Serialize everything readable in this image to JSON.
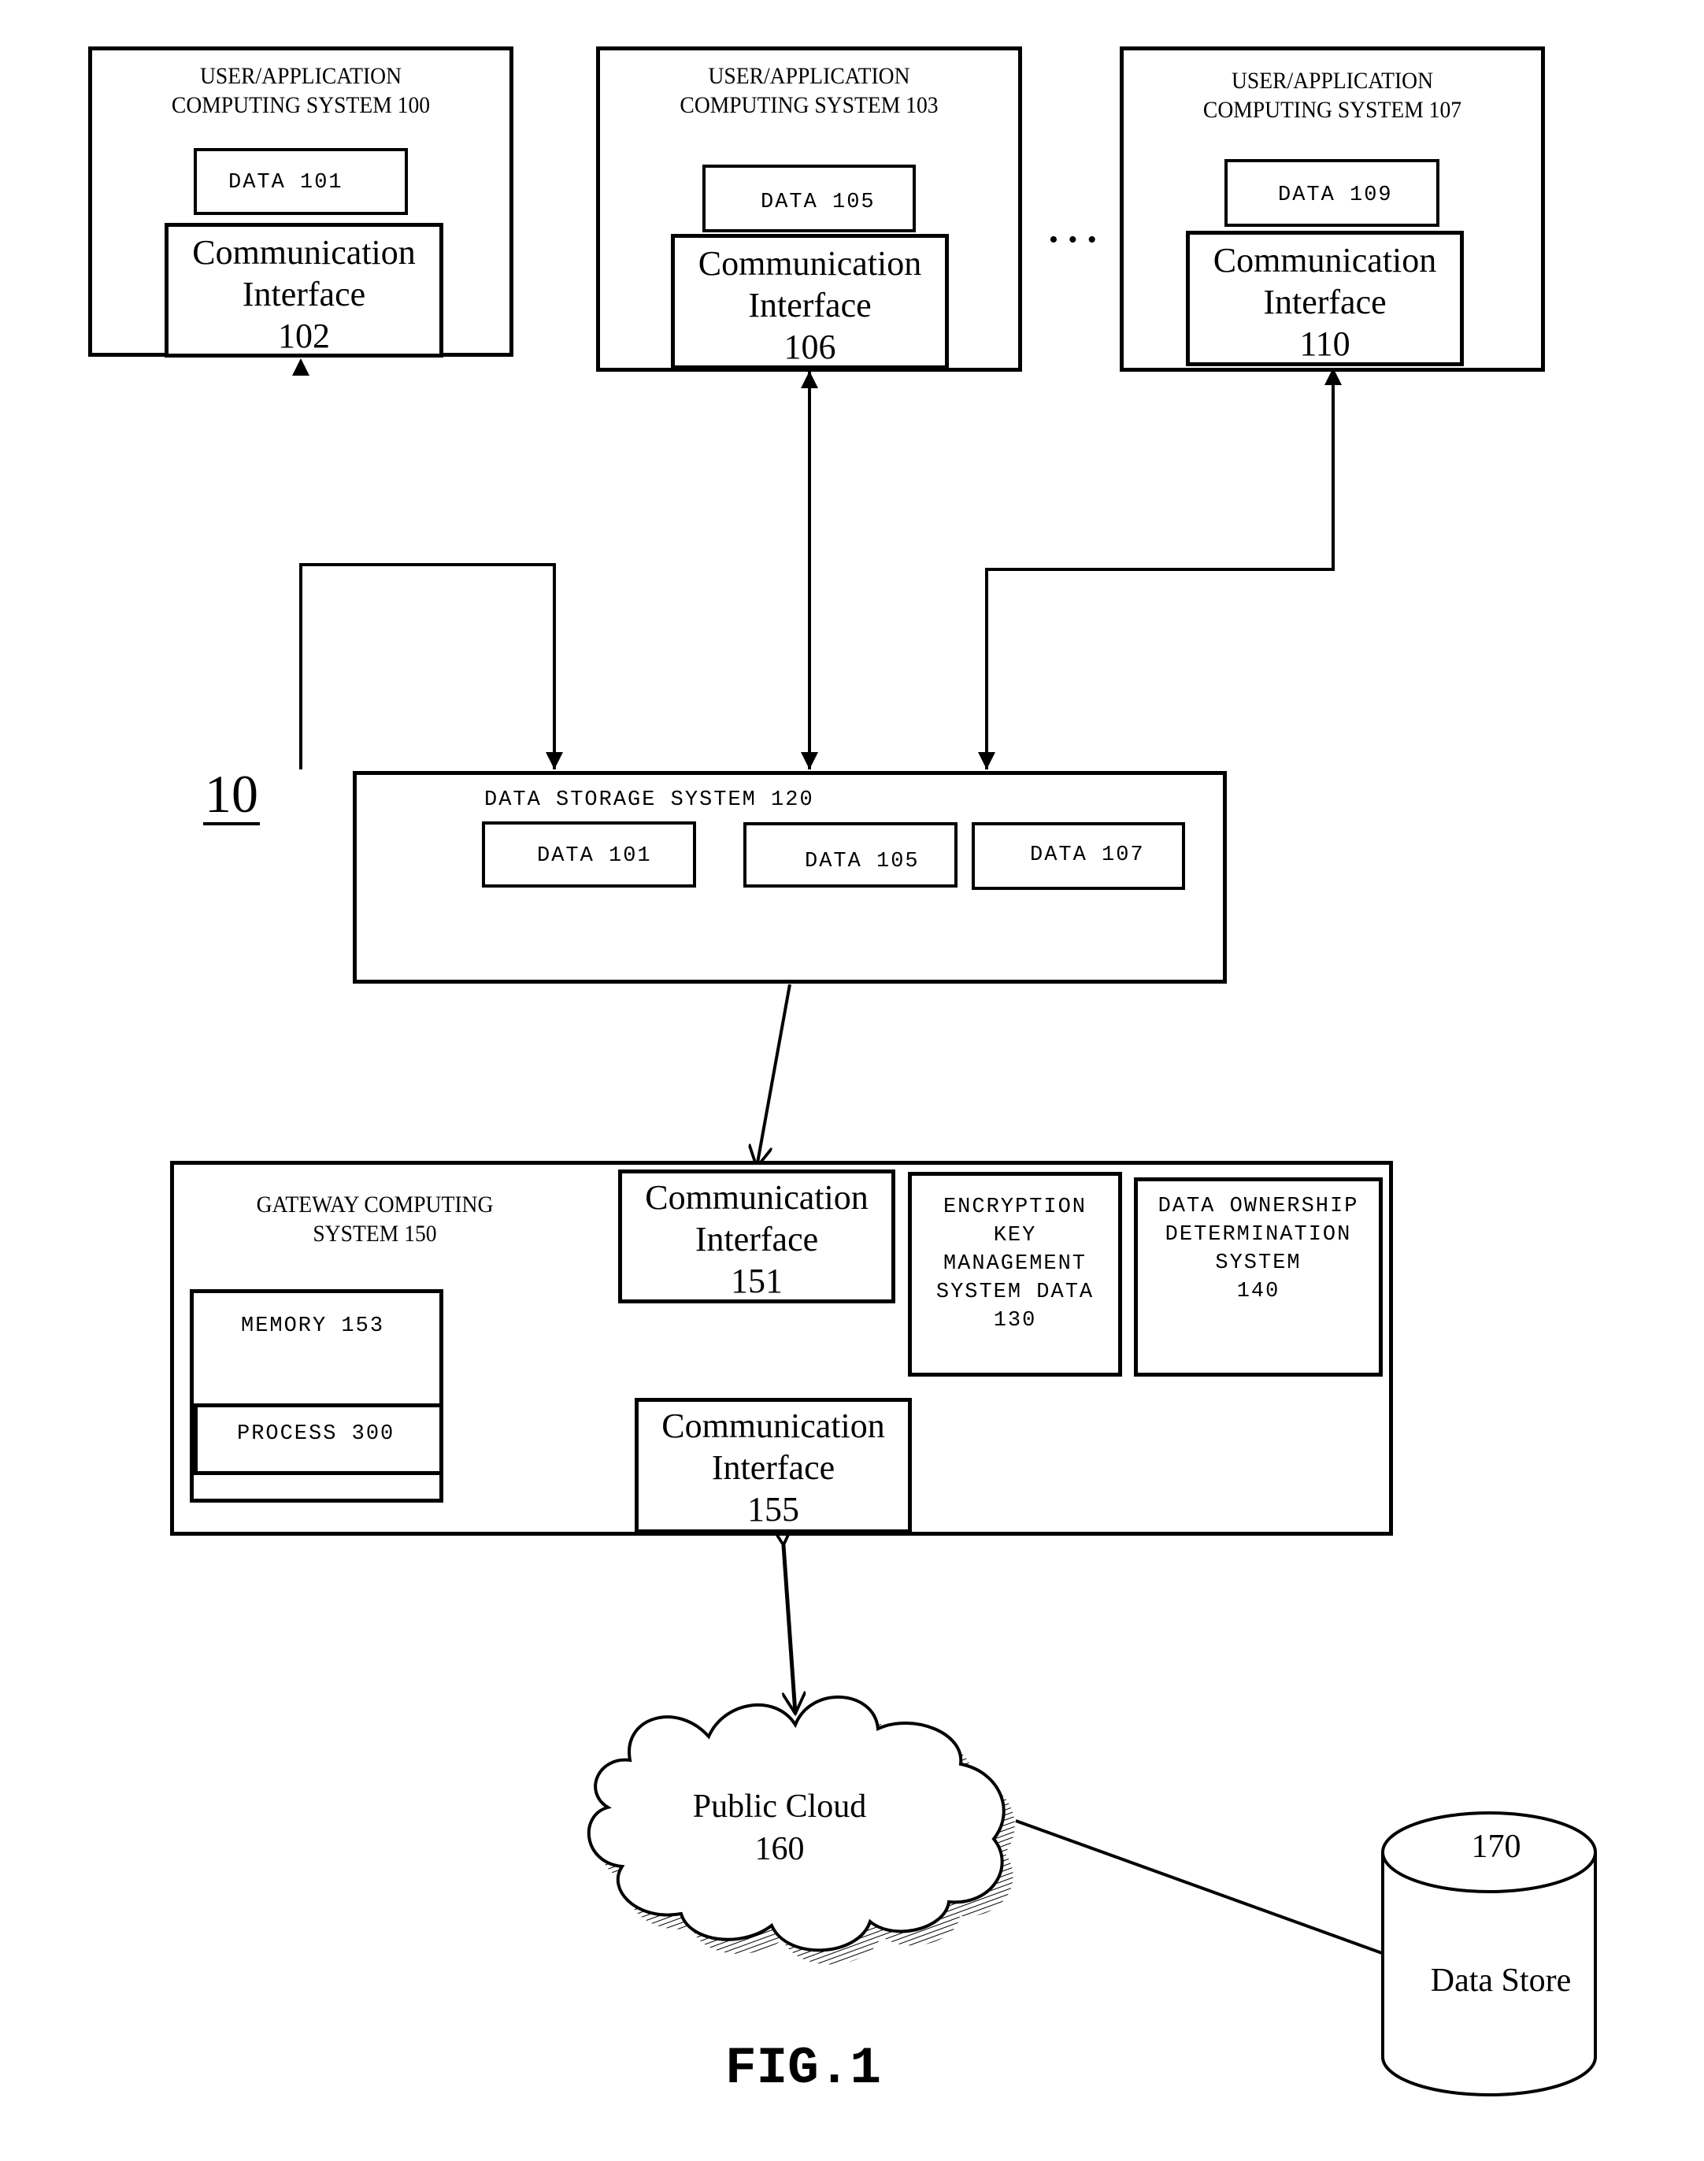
{
  "figure": {
    "reference_label": "10",
    "caption": "FIG.1",
    "ellipsis": "• • •"
  },
  "user_systems": [
    {
      "title_line1": "USER/APPLICATION",
      "title_line2": "COMPUTING SYSTEM 100",
      "data_label": "DATA 101",
      "comm_interface": {
        "line1": "Communication",
        "line2": "Interface",
        "number": "102"
      }
    },
    {
      "title_line1": "USER/APPLICATION",
      "title_line2": "COMPUTING SYSTEM 103",
      "data_label": "DATA 105",
      "comm_interface": {
        "line1": "Communication",
        "line2": "Interface",
        "number": "106"
      }
    },
    {
      "title_line1": "USER/APPLICATION",
      "title_line2": "COMPUTING SYSTEM 107",
      "data_label": "DATA 109",
      "comm_interface": {
        "line1": "Communication",
        "line2": "Interface",
        "number": "110"
      }
    }
  ],
  "data_storage": {
    "title": "DATA STORAGE SYSTEM 120",
    "items": [
      "DATA 101",
      "DATA 105",
      "DATA 107"
    ]
  },
  "gateway": {
    "title_line1": "GATEWAY COMPUTING",
    "title_line2": "SYSTEM 150",
    "memory_label": "MEMORY 153",
    "process_label": "PROCESS 300",
    "comm_interface_151": {
      "line1": "Communication",
      "line2": "Interface",
      "number": "151"
    },
    "comm_interface_155": {
      "line1": "Communication",
      "line2": "Interface",
      "number": "155"
    },
    "encryption": {
      "lines": [
        "ENCRYPTION",
        "KEY",
        "MANAGEMENT",
        "SYSTEM DATA",
        "130"
      ]
    },
    "ownership": {
      "lines": [
        "DATA OWNERSHIP",
        "DETERMINATION",
        "SYSTEM",
        "140"
      ]
    }
  },
  "public_cloud": {
    "line1": "Public Cloud",
    "line2": "160"
  },
  "data_store": {
    "number": "170",
    "label": "Data Store"
  }
}
